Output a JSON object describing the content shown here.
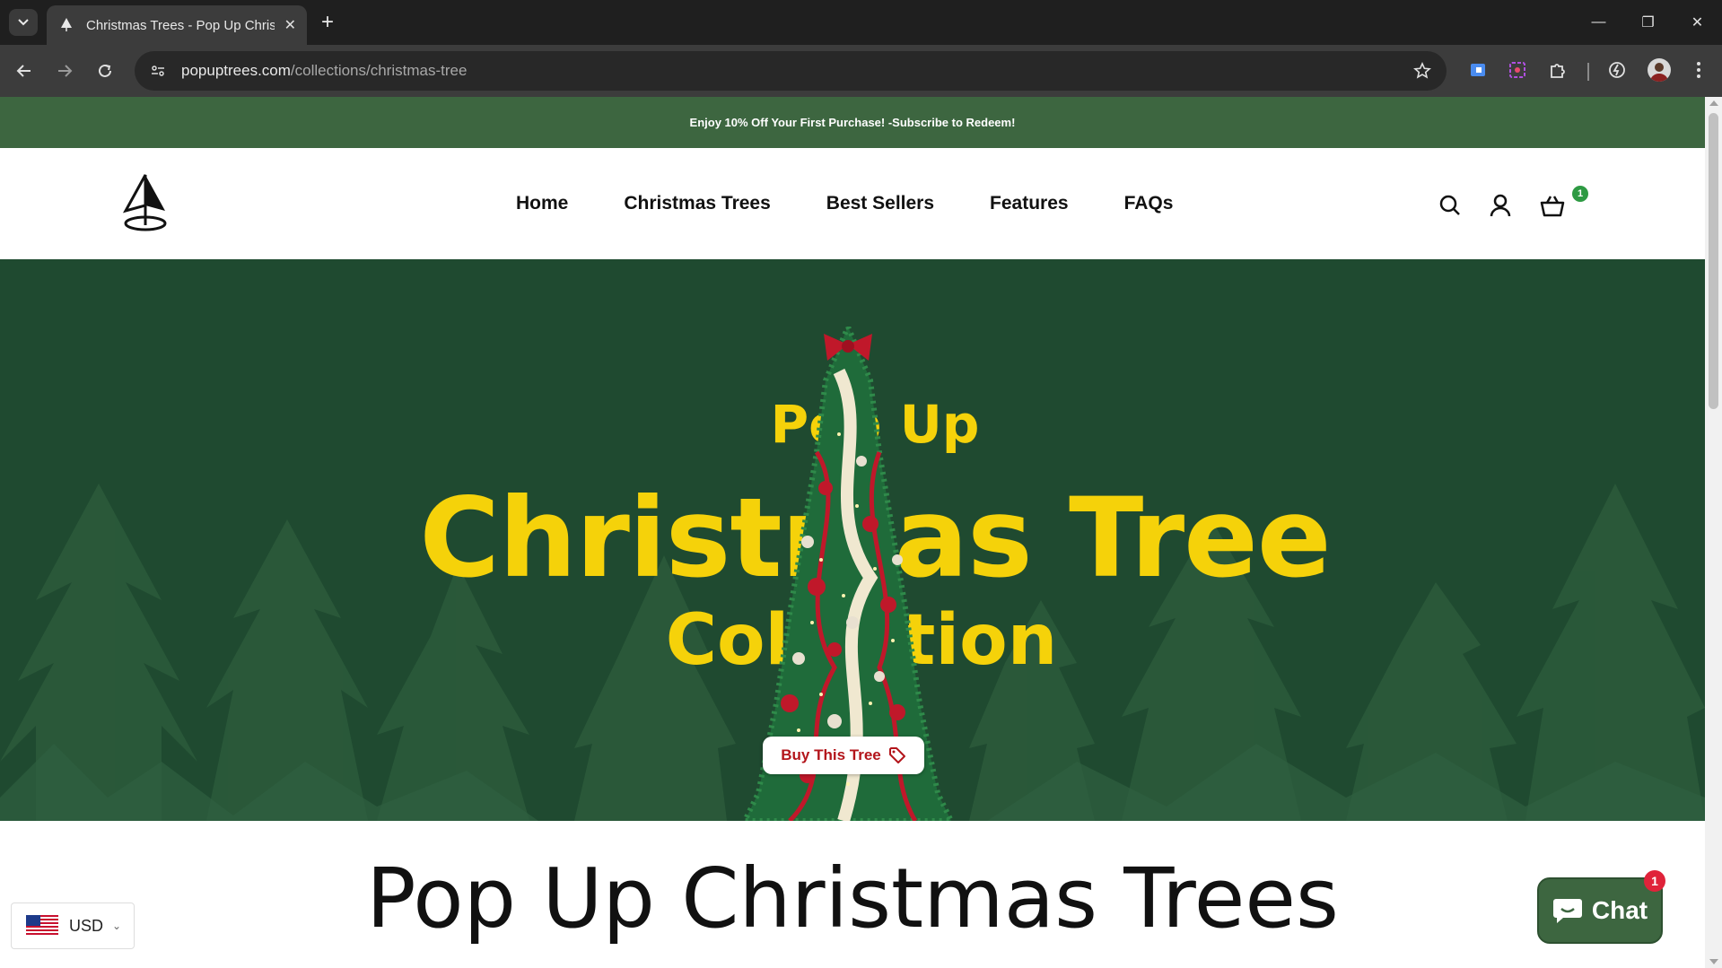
{
  "browser": {
    "tab_title": "Christmas Trees - Pop Up Christ",
    "url_host": "popuptrees.com",
    "url_path": "/collections/christmas-tree"
  },
  "announcement": "Enjoy 10% Off Your First Purchase! -Subscribe to Redeem!",
  "nav": {
    "items": [
      "Home",
      "Christmas Trees",
      "Best Sellers",
      "Features",
      "FAQs"
    ]
  },
  "cart": {
    "count": "1"
  },
  "hero": {
    "line1": "Pop Up",
    "line2": "Christmas Tree",
    "line3": "Collection",
    "button": "Buy This Tree"
  },
  "section": {
    "title": "Pop Up Christmas Trees"
  },
  "currency": {
    "code": "USD"
  },
  "chat": {
    "label": "Chat",
    "badge": "1"
  },
  "colors": {
    "brand_green": "#3d6640",
    "hero_green": "#1f4a30",
    "hero_yellow": "#f5d20a",
    "button_red": "#b3151b"
  }
}
